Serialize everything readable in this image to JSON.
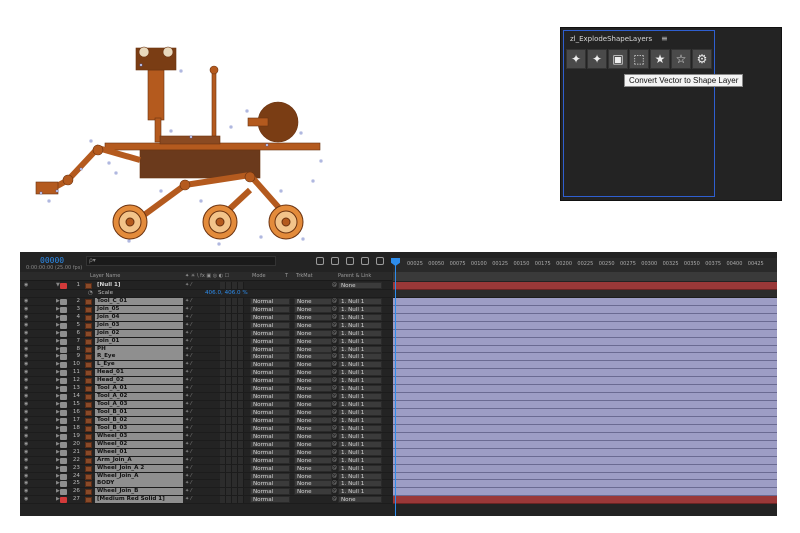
{
  "panel": {
    "title": "zl_ExplodeShapeLayers",
    "menu_icon": "hamburger-menu-icon",
    "buttons": [
      {
        "name": "explode-layers-button",
        "icon": "explode-icon",
        "glyph": "✦"
      },
      {
        "name": "explode-groups-button",
        "icon": "explode-groups-icon",
        "glyph": "✦"
      },
      {
        "name": "convert-vector-button",
        "icon": "convert-vector-icon",
        "glyph": "▣"
      },
      {
        "name": "merge-shapes-button",
        "icon": "bounding-box-icon",
        "glyph": "⬚"
      },
      {
        "name": "star-filled-button",
        "icon": "star-filled-icon",
        "glyph": "★"
      },
      {
        "name": "star-outline-button",
        "icon": "star-outline-icon",
        "glyph": "☆"
      },
      {
        "name": "settings-button",
        "icon": "gear-icon",
        "glyph": "⚙"
      }
    ],
    "tooltip": "Convert Vector to Shape Layer"
  },
  "timeline": {
    "time_code": "00000",
    "frame_rate": "0:00:00:00 (25.00 fps)",
    "search_placeholder": "ρ▾",
    "columns": {
      "layer_name": "Layer Name",
      "switches": "✦ ☀ \\ fx ▣ ◎ ◐ ☐",
      "mode": "Mode",
      "t": "T",
      "trkmat": "TrkMat",
      "parent": "Parent & Link"
    },
    "ruler_ticks": [
      "00025",
      "00050",
      "00075",
      "00100",
      "00125",
      "00150",
      "00175",
      "00200",
      "00225",
      "00250",
      "00275",
      "00300",
      "00325",
      "00350",
      "00375",
      "00400",
      "00425"
    ],
    "rows": [
      {
        "num": "1",
        "name": "[Null 1]",
        "mode": "",
        "trk": "",
        "parent": "None",
        "type": "null",
        "label": "#d33a3a"
      },
      {
        "num": "",
        "name": "Scale",
        "value": "406.0, 406.0 %",
        "type": "sub"
      },
      {
        "num": "2",
        "name": "Tool_C_01",
        "mode": "Normal",
        "trk": "None",
        "parent": "1. Null 1",
        "type": "shape",
        "label": "#8f8f8f"
      },
      {
        "num": "3",
        "name": "Join_05",
        "mode": "Normal",
        "trk": "None",
        "parent": "1. Null 1",
        "type": "shape",
        "label": "#8f8f8f"
      },
      {
        "num": "4",
        "name": "Join_04",
        "mode": "Normal",
        "trk": "None",
        "parent": "1. Null 1",
        "type": "shape",
        "label": "#8f8f8f"
      },
      {
        "num": "5",
        "name": "Join_03",
        "mode": "Normal",
        "trk": "None",
        "parent": "1. Null 1",
        "type": "shape",
        "label": "#8f8f8f"
      },
      {
        "num": "6",
        "name": "Join_02",
        "mode": "Normal",
        "trk": "None",
        "parent": "1. Null 1",
        "type": "shape",
        "label": "#8f8f8f"
      },
      {
        "num": "7",
        "name": "Join_01",
        "mode": "Normal",
        "trk": "None",
        "parent": "1. Null 1",
        "type": "shape",
        "label": "#8f8f8f"
      },
      {
        "num": "8",
        "name": "PH",
        "mode": "Normal",
        "trk": "None",
        "parent": "1. Null 1",
        "type": "shape",
        "label": "#8f8f8f"
      },
      {
        "num": "9",
        "name": "R_Eye",
        "mode": "Normal",
        "trk": "None",
        "parent": "1. Null 1",
        "type": "shape",
        "label": "#8f8f8f"
      },
      {
        "num": "10",
        "name": "L_Eye",
        "mode": "Normal",
        "trk": "None",
        "parent": "1. Null 1",
        "type": "shape",
        "label": "#8f8f8f"
      },
      {
        "num": "11",
        "name": "Head_01",
        "mode": "Normal",
        "trk": "None",
        "parent": "1. Null 1",
        "type": "shape",
        "label": "#8f8f8f"
      },
      {
        "num": "12",
        "name": "Head_02",
        "mode": "Normal",
        "trk": "None",
        "parent": "1. Null 1",
        "type": "shape",
        "label": "#8f8f8f"
      },
      {
        "num": "13",
        "name": "Tool_A_01",
        "mode": "Normal",
        "trk": "None",
        "parent": "1. Null 1",
        "type": "shape",
        "label": "#8f8f8f"
      },
      {
        "num": "14",
        "name": "Tool_A_02",
        "mode": "Normal",
        "trk": "None",
        "parent": "1. Null 1",
        "type": "shape",
        "label": "#8f8f8f"
      },
      {
        "num": "15",
        "name": "Tool_A_03",
        "mode": "Normal",
        "trk": "None",
        "parent": "1. Null 1",
        "type": "shape",
        "label": "#8f8f8f"
      },
      {
        "num": "16",
        "name": "Tool_B_01",
        "mode": "Normal",
        "trk": "None",
        "parent": "1. Null 1",
        "type": "shape",
        "label": "#8f8f8f"
      },
      {
        "num": "17",
        "name": "Tool_B_02",
        "mode": "Normal",
        "trk": "None",
        "parent": "1. Null 1",
        "type": "shape",
        "label": "#8f8f8f"
      },
      {
        "num": "18",
        "name": "Tool_B_03",
        "mode": "Normal",
        "trk": "None",
        "parent": "1. Null 1",
        "type": "shape",
        "label": "#8f8f8f"
      },
      {
        "num": "19",
        "name": "Wheel_03",
        "mode": "Normal",
        "trk": "None",
        "parent": "1. Null 1",
        "type": "shape",
        "label": "#8f8f8f"
      },
      {
        "num": "20",
        "name": "Wheel_02",
        "mode": "Normal",
        "trk": "None",
        "parent": "1. Null 1",
        "type": "shape",
        "label": "#8f8f8f"
      },
      {
        "num": "21",
        "name": "Wheel_01",
        "mode": "Normal",
        "trk": "None",
        "parent": "1. Null 1",
        "type": "shape",
        "label": "#8f8f8f"
      },
      {
        "num": "22",
        "name": "Arm_Join_A",
        "mode": "Normal",
        "trk": "None",
        "parent": "1. Null 1",
        "type": "shape",
        "label": "#8f8f8f"
      },
      {
        "num": "23",
        "name": "Wheel_Join_A 2",
        "mode": "Normal",
        "trk": "None",
        "parent": "1. Null 1",
        "type": "shape",
        "label": "#8f8f8f"
      },
      {
        "num": "24",
        "name": "Wheel_Join_A",
        "mode": "Normal",
        "trk": "None",
        "parent": "1. Null 1",
        "type": "shape",
        "label": "#8f8f8f"
      },
      {
        "num": "25",
        "name": "BODY",
        "mode": "Normal",
        "trk": "None",
        "parent": "1. Null 1",
        "type": "shape",
        "label": "#8f8f8f"
      },
      {
        "num": "26",
        "name": "Wheel_Join_B",
        "mode": "Normal",
        "trk": "None",
        "parent": "1. Null 1",
        "type": "shape",
        "label": "#8f8f8f"
      },
      {
        "num": "27",
        "name": "[Medium Red Solid 1]",
        "mode": "Normal",
        "trk": "",
        "parent": "None",
        "type": "solid",
        "label": "#d33a3a"
      }
    ]
  },
  "colors": {
    "accent": "#2d8ceb",
    "rover_orange": "#b45a1e",
    "rover_brown": "#7a3d14",
    "layer_bar": "#9d9dc5",
    "null_bar": "#9a3838"
  }
}
